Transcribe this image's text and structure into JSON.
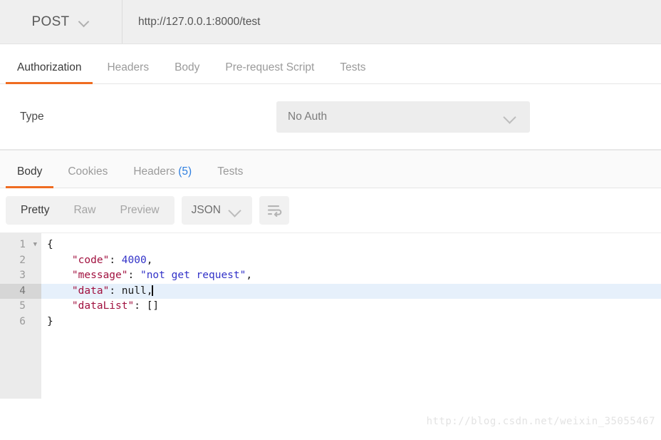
{
  "request": {
    "method": "POST",
    "url": "http://127.0.0.1:8000/test",
    "tabs": [
      {
        "label": "Authorization",
        "active": true
      },
      {
        "label": "Headers",
        "active": false
      },
      {
        "label": "Body",
        "active": false
      },
      {
        "label": "Pre-request Script",
        "active": false
      },
      {
        "label": "Tests",
        "active": false
      }
    ],
    "auth": {
      "type_label": "Type",
      "type_value": "No Auth"
    }
  },
  "response": {
    "tabs": [
      {
        "label": "Body",
        "count": "",
        "active": true
      },
      {
        "label": "Cookies",
        "count": "",
        "active": false
      },
      {
        "label": "Headers",
        "count": "(5)",
        "active": false
      },
      {
        "label": "Tests",
        "count": "",
        "active": false
      }
    ],
    "view_modes": [
      {
        "label": "Pretty",
        "active": true
      },
      {
        "label": "Raw",
        "active": false
      },
      {
        "label": "Preview",
        "active": false
      }
    ],
    "format": "JSON",
    "wrap_icon": "wrap-lines-icon",
    "body": {
      "language": "json",
      "highlighted_line": 4,
      "lines": [
        {
          "num": "1",
          "foldable": true,
          "text": "{"
        },
        {
          "num": "2",
          "foldable": false,
          "text": "    \"code\": 4000,"
        },
        {
          "num": "3",
          "foldable": false,
          "text": "    \"message\": \"not get request\","
        },
        {
          "num": "4",
          "foldable": false,
          "text": "    \"data\": null,"
        },
        {
          "num": "5",
          "foldable": false,
          "text": "    \"dataList\": []"
        },
        {
          "num": "6",
          "foldable": false,
          "text": "}"
        }
      ],
      "parsed": {
        "code": 4000,
        "message": "not get request",
        "data": null,
        "dataList": []
      }
    }
  },
  "watermark": "http://blog.csdn.net/weixin_35055467",
  "colors": {
    "accent": "#ef6c21",
    "link": "#2f7fe0",
    "json_key": "#a1113f",
    "json_value": "#3232c8",
    "highlight_line": "#e6f0fb"
  }
}
